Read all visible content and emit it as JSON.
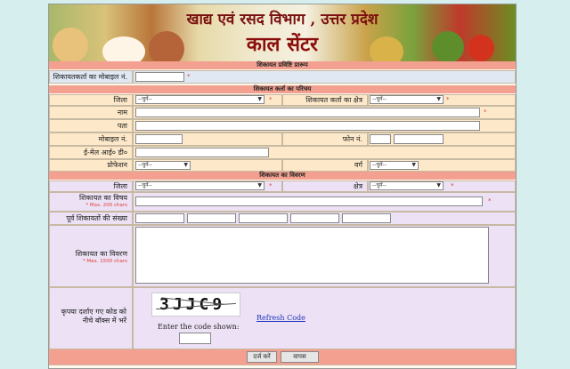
{
  "banner": {
    "title_line1": "खाद्य एवं रसद विभाग , उत्तर प्रदेश",
    "title_line2": "काल सेंटर"
  },
  "sections": {
    "entry": "शिकायत प्रविष्टि प्रारूप",
    "complainant": "शिकायत कर्ता का परिचय",
    "details": "शिकायत का विवरण"
  },
  "fields": {
    "mobile_label": "शिकायतकर्ता का मोबाइल नं.",
    "district_label": "जिला",
    "area_label": "शिकायत कर्ता का क्षेत्र",
    "name_label": "नाम",
    "address_label": "पता",
    "mobile2_label": "मोबाइल नं.",
    "phone_label": "फोन नं.",
    "email_label": "ई-मेल आई० डी०",
    "profession_label": "प्रोफेशन",
    "class_label": "वर्ग",
    "district2_label": "जिला",
    "area2_label": "क्षेत्र",
    "subject_label": "शिकायत का विषय",
    "subject_hint": "* Max. 200 chars",
    "prev_label": "पूर्व शिकायतों की संख्या",
    "desc_label": "शिकायत का विवरण",
    "desc_hint": "* Max. 1500 chars",
    "captcha_label": "कृपया दर्शाए गए कोड को नीचे बॉक्स में भरें",
    "captcha_code": "3JJC9",
    "refresh": "Refresh Code",
    "enter_code": "Enter the code shown:",
    "select_placeholder": "--चुनें--",
    "required": "*"
  },
  "buttons": {
    "submit": "दर्ज करें",
    "back": "वापस"
  }
}
